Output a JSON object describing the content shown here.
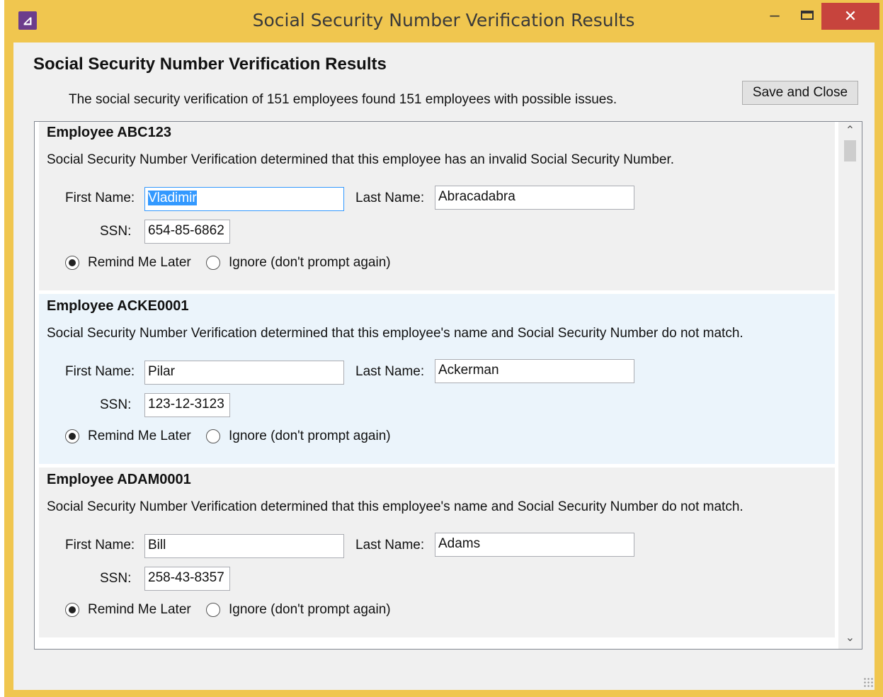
{
  "window": {
    "title": "Social Security Number Verification Results",
    "app_icon": "ruler-triangle-icon",
    "minimize_glyph": "–",
    "close_glyph": "✕"
  },
  "heading": "Social Security Number Verification Results",
  "summary": "The social security verification of 151 employees found 151 employees with possible issues.",
  "save_close_label": "Save and Close",
  "labels": {
    "first_name": "First Name:",
    "last_name": "Last Name:",
    "ssn": "SSN:",
    "remind": "Remind Me Later",
    "ignore": "Ignore (don't prompt again)"
  },
  "employees": [
    {
      "title": "Employee ABC123",
      "message": "Social Security Number Verification determined that this employee has an invalid Social Security Number.",
      "first_name": "Vladimir",
      "last_name": "Abracadabra",
      "ssn": "654-85-6862",
      "choice": "remind"
    },
    {
      "title": "Employee ACKE0001",
      "message": "Social Security Number Verification determined that this employee's name and Social Security Number do not match.",
      "first_name": "Pilar",
      "last_name": "Ackerman",
      "ssn": "123-12-3123",
      "choice": "remind"
    },
    {
      "title": "Employee ADAM0001",
      "message": "Social Security Number Verification determined that this employee's name and Social Security Number do not match.",
      "first_name": "Bill",
      "last_name": "Adams",
      "ssn": "258-43-8357",
      "choice": "remind"
    }
  ],
  "scroll": {
    "up_glyph": "⌃",
    "down_glyph": "⌄"
  },
  "colors": {
    "frame": "#f0c64f",
    "close_button": "#c7443d",
    "selected_card": "#ebf4fb",
    "text_selection": "#3399ff"
  }
}
